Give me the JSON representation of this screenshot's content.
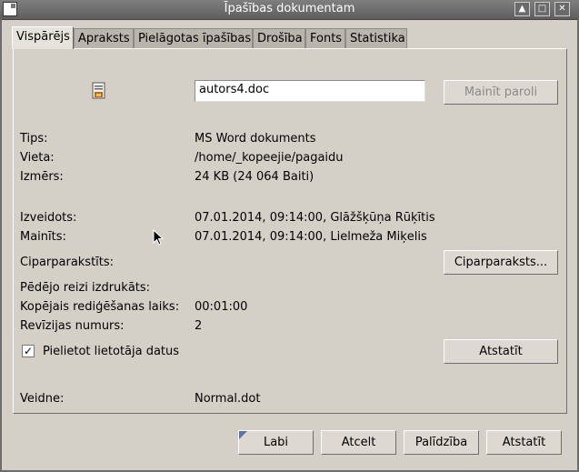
{
  "window": {
    "title": "Īpašības dokumentam"
  },
  "tabs": [
    "Vispārējs",
    "Apraksts",
    "Pielāgotas īpašības",
    "Drošība",
    "Fonts",
    "Statistika"
  ],
  "file": {
    "name": "autors4.doc",
    "change_password_label": "Mainīt paroli"
  },
  "info": {
    "type_label": "Tips:",
    "type_value": "MS Word dokuments",
    "location_label": "Vieta:",
    "location_value": "/home/_kopeejie/pagaidu",
    "size_label": "Izmērs:",
    "size_value": "24 KB (24 064 Baiti)",
    "created_label": "Izveidots:",
    "created_value": "07.01.2014, 09:14:00, Glāžšķūņa Rūķītis",
    "modified_label": "Mainīts:",
    "modified_value": "07.01.2014, 09:14:00, Lielmeža Miķelis",
    "signed_label": "Ciparparakstīts:",
    "signature_button": "Ciparparaksts...",
    "printed_label": "Pēdējo reizi izdrukāts:",
    "editing_time_label": "Kopējais rediģēšanas laiks:",
    "editing_time_value": "00:01:00",
    "revision_label": "Revīzijas numurs:",
    "revision_value": "2",
    "apply_user_data_label": "Pielietot lietotāja datus",
    "reset_label": "Atstatīt",
    "template_label": "Veidne:",
    "template_value": "Normal.dot"
  },
  "footer": {
    "ok": "Labi",
    "cancel": "Atcelt",
    "help": "Palīdzība",
    "reset": "Atstatīt"
  },
  "colors": {
    "titlebar": "#6a6a6a",
    "dialog_bg": "#d4d0c8",
    "default_marker": "#5875a8"
  }
}
